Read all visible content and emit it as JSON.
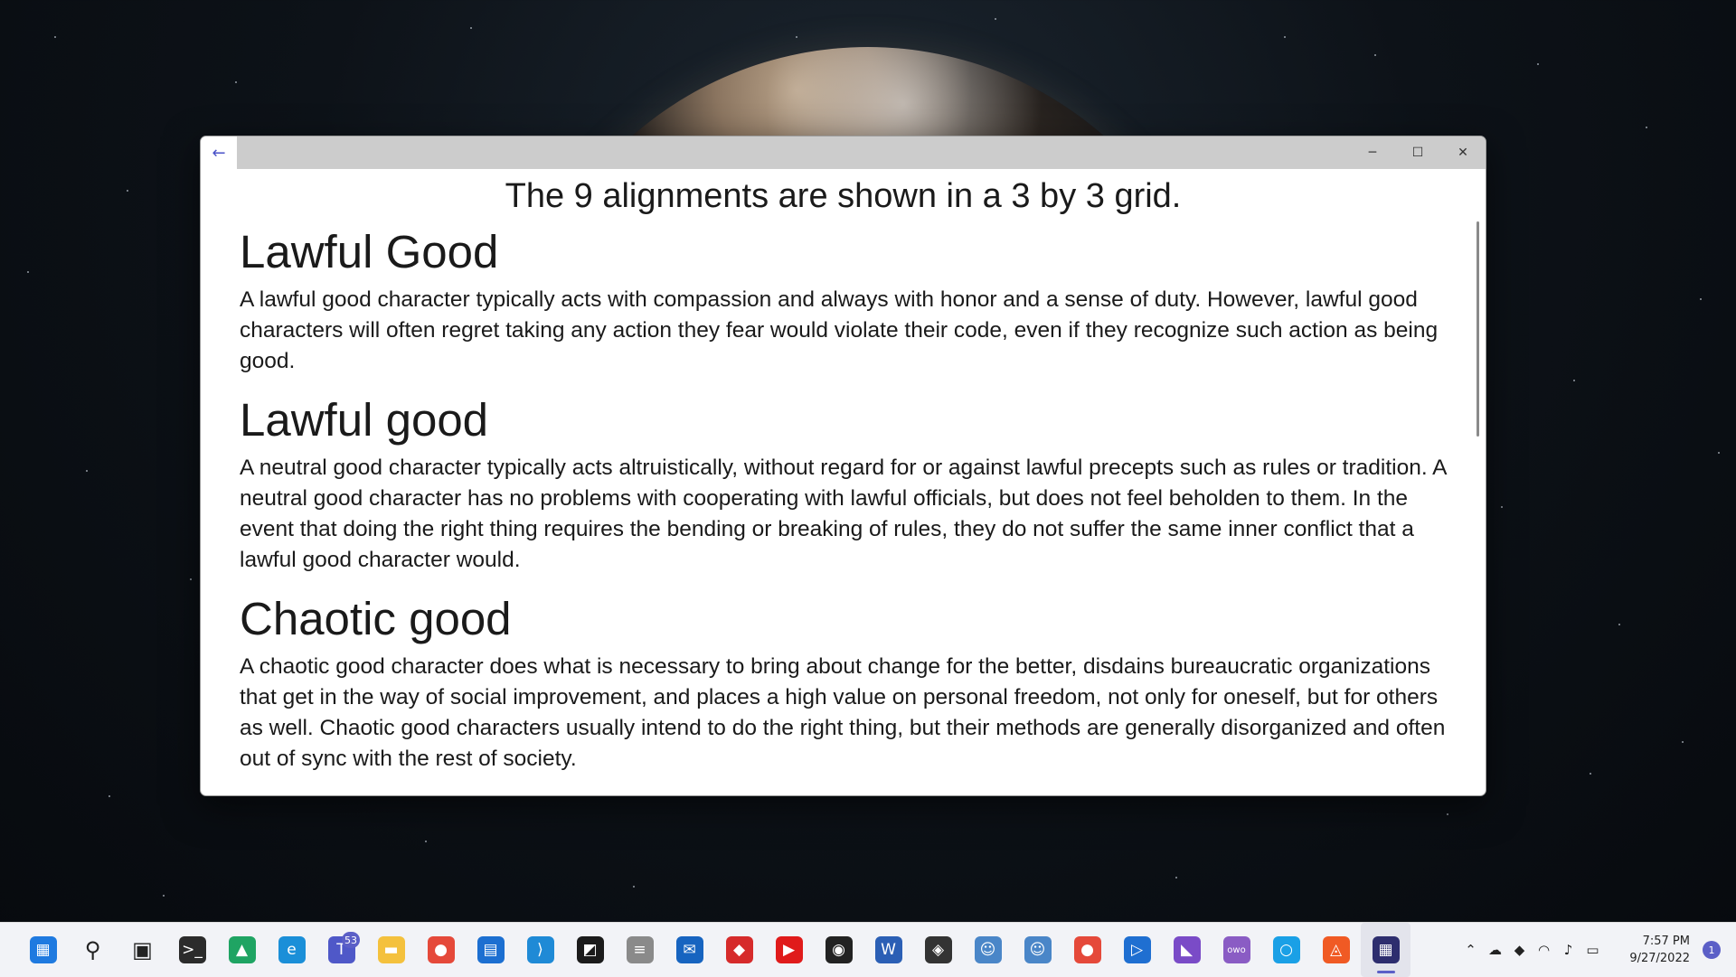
{
  "window": {
    "back_icon": "←",
    "minimize_icon": "─",
    "maximize_icon": "☐",
    "close_icon": "✕"
  },
  "content": {
    "subtitle": "The 9 alignments are shown in a 3 by 3 grid.",
    "sections": [
      {
        "heading": "Lawful Good",
        "body": "A lawful good character typically acts with compassion and always with honor and a sense of duty. However, lawful good characters will often regret taking any action they fear would violate their code, even if they recognize such action as being good."
      },
      {
        "heading": "Lawful good",
        "body": "A neutral good character typically acts altruistically, without regard for or against lawful precepts such as rules or tradition. A neutral good character has no problems with cooperating with lawful officials, but does not feel beholden to them. In the event that doing the right thing requires the bending or breaking of rules, they do not suffer the same inner conflict that a lawful good character would."
      },
      {
        "heading": "Chaotic good",
        "body": "A chaotic good character does what is necessary to bring about change for the better, disdains bureaucratic organizations that get in the way of social improvement, and places a high value on personal freedom, not only for oneself, but for others as well. Chaotic good characters usually intend to do the right thing, but their methods are generally disorganized and often out of sync with the rest of society."
      }
    ]
  },
  "taskbar": {
    "apps": [
      {
        "name": "start-icon",
        "glyph": "▦",
        "color": "#1f7ae0"
      },
      {
        "name": "search-icon",
        "glyph": "⚲",
        "color": "#222222"
      },
      {
        "name": "task-view-icon",
        "glyph": "▣",
        "color": "#222222"
      },
      {
        "name": "terminal-icon",
        "glyph": ">_",
        "color": "#2b2b2b"
      },
      {
        "name": "google-drive-icon",
        "glyph": "▲",
        "color": "#1fa463"
      },
      {
        "name": "edge-icon",
        "glyph": "e",
        "color": "#1b8fd8"
      },
      {
        "name": "teams-icon",
        "glyph": "T",
        "color": "#4f58c8",
        "badge": "53"
      },
      {
        "name": "file-explorer-icon",
        "glyph": "▬",
        "color": "#f4c13d"
      },
      {
        "name": "chrome-icon",
        "glyph": "●",
        "color": "#e5493a"
      },
      {
        "name": "store-icon",
        "glyph": "▤",
        "color": "#1c6fd1"
      },
      {
        "name": "vscode-icon",
        "glyph": "⟩",
        "color": "#1f8ad6"
      },
      {
        "name": "app-icon",
        "glyph": "◩",
        "color": "#1b1b1b"
      },
      {
        "name": "database-icon",
        "glyph": "≡",
        "color": "#8a8a8a"
      },
      {
        "name": "mail-icon",
        "glyph": "✉",
        "color": "#1764c0"
      },
      {
        "name": "app-red-icon",
        "glyph": "◆",
        "color": "#d62b2b"
      },
      {
        "name": "youtube-music-icon",
        "glyph": "▶",
        "color": "#e01b1b"
      },
      {
        "name": "github-icon",
        "glyph": "◉",
        "color": "#222222"
      },
      {
        "name": "word-icon",
        "glyph": "W",
        "color": "#2b5fb5"
      },
      {
        "name": "unity-icon",
        "glyph": "◈",
        "color": "#333333"
      },
      {
        "name": "godot-icon",
        "glyph": "☺",
        "color": "#4a86c8"
      },
      {
        "name": "godot-2-icon",
        "glyph": "☺",
        "color": "#4a86c8"
      },
      {
        "name": "chrome-canary-icon",
        "glyph": "●",
        "color": "#e5493a"
      },
      {
        "name": "media-player-icon",
        "glyph": "▷",
        "color": "#1f6fd1"
      },
      {
        "name": "visual-studio-icon",
        "glyph": "◣",
        "color": "#7a4bc7"
      },
      {
        "name": "owo-icon",
        "glyph": "owo",
        "color": "#8a5cc4"
      },
      {
        "name": "cortana-icon",
        "glyph": "○",
        "color": "#1aa0e6"
      },
      {
        "name": "brave-icon",
        "glyph": "◬",
        "color": "#f05a24"
      },
      {
        "name": "grid-app-icon",
        "glyph": "▦",
        "color": "#2d2d6e"
      }
    ],
    "tray_icons": [
      {
        "name": "chevron-up-icon",
        "glyph": "⌃"
      },
      {
        "name": "onedrive-icon",
        "glyph": "☁"
      },
      {
        "name": "dropbox-icon",
        "glyph": "◆"
      },
      {
        "name": "wifi-icon",
        "glyph": "◠"
      },
      {
        "name": "volume-icon",
        "glyph": "♪"
      },
      {
        "name": "battery-icon",
        "glyph": "▭"
      }
    ],
    "time": "7:57 PM",
    "date": "9/27/2022",
    "notification_count": "1"
  }
}
